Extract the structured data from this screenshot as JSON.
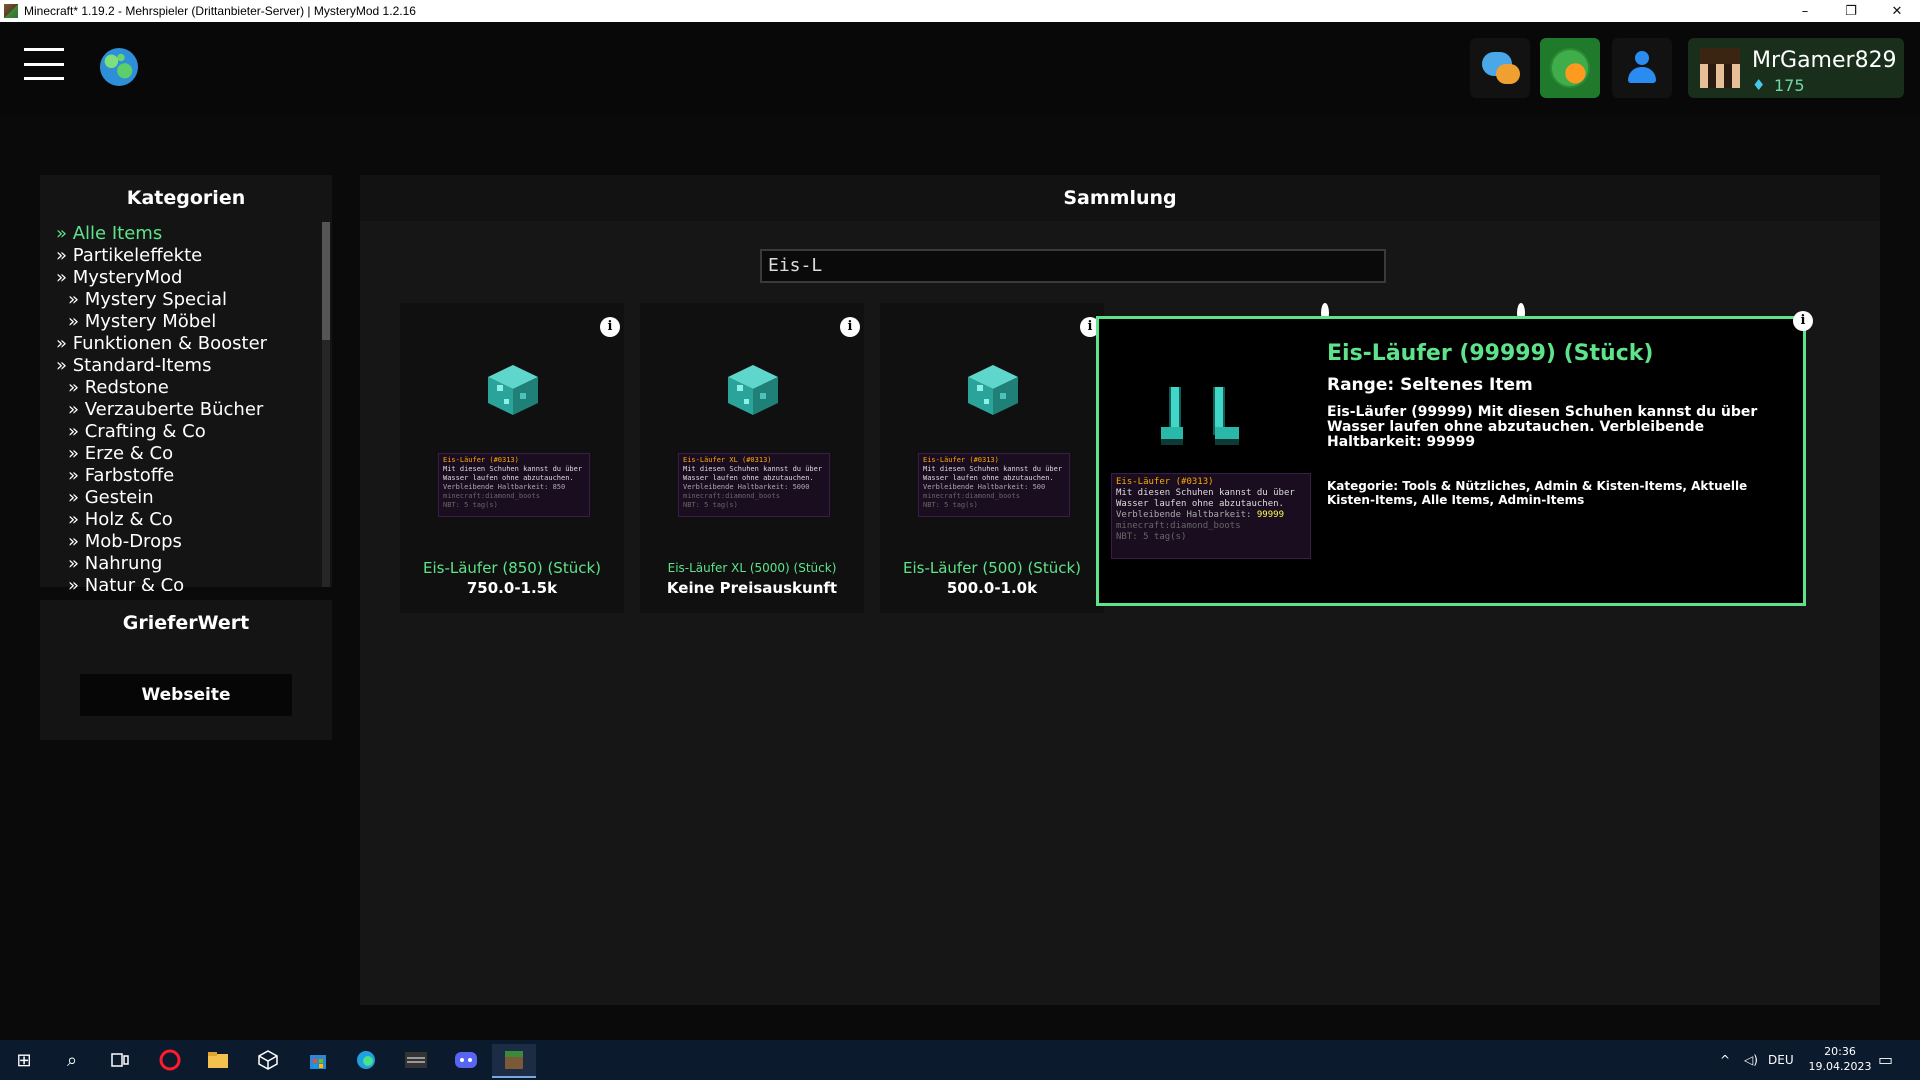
{
  "window": {
    "title": "Minecraft* 1.19.2 - Mehrspieler (Drittanbieter-Server) | MysteryMod 1.2.16",
    "minimize": "–",
    "restore": "❐",
    "close": "✕"
  },
  "topbar": {
    "profile": {
      "name": "MrGamer829",
      "gem_icon": "♦",
      "gems": "175"
    }
  },
  "sidebar": {
    "title": "Kategorien",
    "items": [
      {
        "label": "» Alle Items",
        "level": 0,
        "active": true
      },
      {
        "label": "» Partikeleffekte",
        "level": 0
      },
      {
        "label": "» MysteryMod",
        "level": 0
      },
      {
        "label": "» Mystery Special",
        "level": 1
      },
      {
        "label": "» Mystery Möbel",
        "level": 1
      },
      {
        "label": "» Funktionen & Booster",
        "level": 0
      },
      {
        "label": "» Standard-Items",
        "level": 0
      },
      {
        "label": "» Redstone",
        "level": 1
      },
      {
        "label": "» Verzauberte Bücher",
        "level": 1
      },
      {
        "label": "» Crafting & Co",
        "level": 1
      },
      {
        "label": "» Erze & Co",
        "level": 1
      },
      {
        "label": "» Farbstoffe",
        "level": 1
      },
      {
        "label": "» Gestein",
        "level": 1
      },
      {
        "label": "» Holz & Co",
        "level": 1
      },
      {
        "label": "» Mob-Drops",
        "level": 1
      },
      {
        "label": "» Nahrung",
        "level": 1
      },
      {
        "label": "» Natur & Co",
        "level": 1
      }
    ]
  },
  "grief": {
    "title": "GrieferWert",
    "button": "Webseite"
  },
  "main": {
    "title": "Sammlung",
    "search_value": "Eis-L",
    "info_glyph": "i",
    "cards": [
      {
        "name": "Eis-Läufer (850) (Stück)",
        "price": "750.0-1.5k",
        "tip_title": "Eis-Läufer (#0313)",
        "tip_desc": "Mit diesen Schuhen kannst du über Wasser laufen ohne abzutauchen.",
        "tip_dur": "Verbleibende Haltbarkeit: 850",
        "tip_id": "minecraft:diamond_boots",
        "tip_nbt": "NBT: 5 tag(s)"
      },
      {
        "name": "Eis-Läufer XL (5000) (Stück)",
        "price": "Keine Preisauskunft",
        "tip_title": "Eis-Läufer XL (#0313)",
        "tip_desc": "Mit diesen Schuhen kannst du über Wasser laufen ohne abzutauchen.",
        "tip_dur": "Verbleibende Haltbarkeit: 5000",
        "tip_id": "minecraft:diamond_boots",
        "tip_nbt": "NBT: 5 tag(s)"
      },
      {
        "name": "Eis-Läufer (500) (Stück)",
        "price": "500.0-1.0k",
        "tip_title": "Eis-Läufer (#0313)",
        "tip_desc": "Mit diesen Schuhen kannst du über Wasser laufen ohne abzutauchen.",
        "tip_dur": "Verbleibende Haltbarkeit: 500",
        "tip_id": "minecraft:diamond_boots",
        "tip_nbt": "NBT: 5 tag(s)"
      }
    ]
  },
  "detail": {
    "title": "Eis-Läufer (99999) (Stück)",
    "range": "Range: Seltenes Item",
    "description": "Eis-Läufer (99999) Mit diesen Schuhen kannst du über Wasser laufen ohne abzutauchen. Verbleibende Haltbarkeit: 99999",
    "categories": "Kategorie: Tools & Nützliches, Admin & Kisten-Items, Aktuelle Kisten-Items, Alle Items, Admin-Items",
    "tip_title": "Eis-Läufer (#0313)",
    "tip_desc": "Mit diesen Schuhen kannst du über Wasser laufen ohne abzutauchen.",
    "tip_dur_label": "Verbleibende Haltbarkeit:",
    "tip_dur_value": "99999",
    "tip_id": "minecraft:diamond_boots",
    "tip_nbt": "NBT: 5 tag(s)"
  },
  "taskbar": {
    "start_glyph": "⊞",
    "search_glyph": "⌕",
    "tray_arrow": "^",
    "volume_glyph": "◁)",
    "language": "DEU",
    "time": "20:36",
    "date": "19.04.2023",
    "notify_glyph": "▭"
  },
  "colors": {
    "accent_green": "#5ee38a",
    "tooltip_bg": "#1a0d20",
    "gold": "#ffaa00"
  }
}
